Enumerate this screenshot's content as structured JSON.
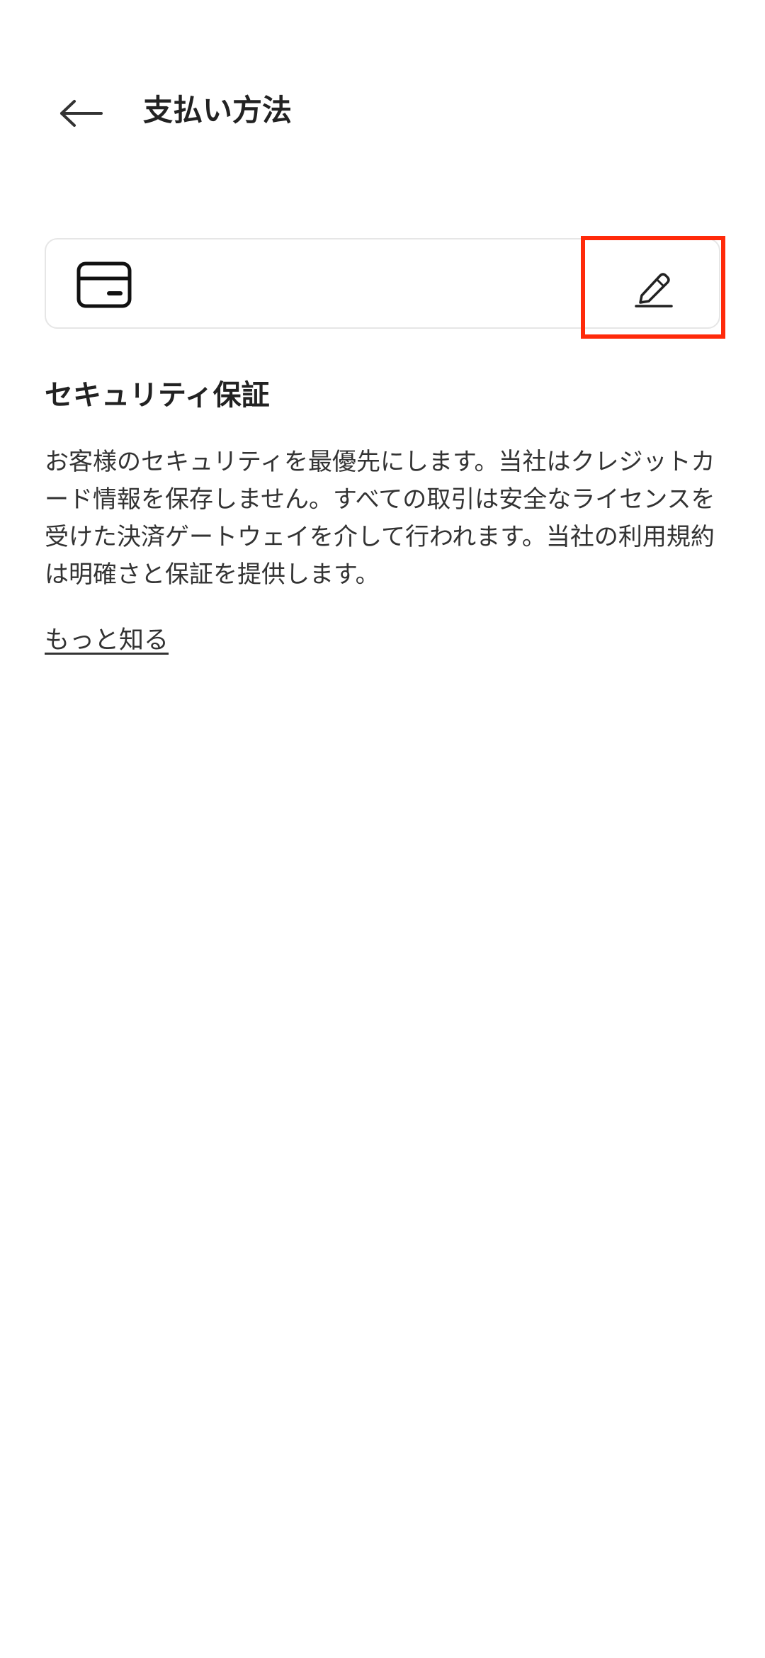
{
  "header": {
    "title": "支払い方法",
    "back_icon": "arrow-left-icon"
  },
  "payment_card": {
    "card_icon": "credit-card-icon",
    "edit_icon": "pencil-icon",
    "edit_highlight_color": "#ff2a0a"
  },
  "security": {
    "title": "セキュリティ保証",
    "body": "お客様のセキュリティを最優先にします。当社はクレジットカード情報を保存しません。すべての取引は安全なライセンスを受けた決済ゲートウェイを介して行われます。当社の利用規約は明確さと保証を提供します。",
    "learn_more": "もっと知る"
  }
}
